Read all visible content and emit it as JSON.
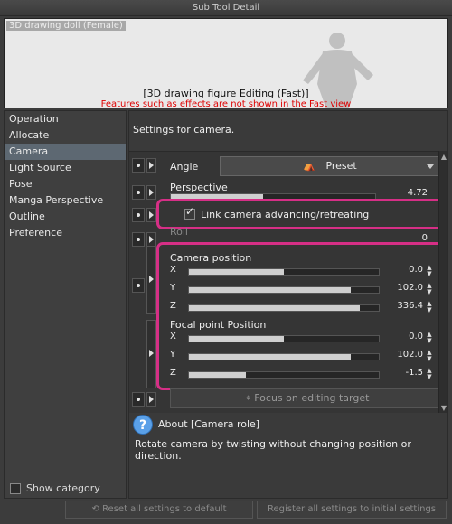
{
  "window": {
    "title": "Sub Tool Detail"
  },
  "preview": {
    "doll_name": "3D drawing doll (Female)",
    "mode_text": "[3D drawing figure Editing (Fast)]",
    "warning_text": "Features such as effects are not shown in the Fast view"
  },
  "sidebar": {
    "items": [
      {
        "label": "Operation"
      },
      {
        "label": "Allocate"
      },
      {
        "label": "Camera"
      },
      {
        "label": "Light Source"
      },
      {
        "label": "Pose"
      },
      {
        "label": "Manga Perspective"
      },
      {
        "label": "Outline"
      },
      {
        "label": "Preference"
      }
    ],
    "active": "Camera",
    "show_category_label": "Show category"
  },
  "main": {
    "heading": "Settings for camera.",
    "angle": {
      "label": "Angle",
      "preset_label": "Preset"
    },
    "perspective": {
      "label": "Perspective",
      "value": "4.72"
    },
    "link_camera": {
      "label": "Link camera advancing/retreating",
      "checked": true
    },
    "roll": {
      "label": "Roll",
      "value": "0"
    },
    "camera_position": {
      "label": "Camera position",
      "x": {
        "axis": "X",
        "value": "0.0",
        "level": 0.5
      },
      "y": {
        "axis": "Y",
        "value": "102.0",
        "level": 0.85
      },
      "z": {
        "axis": "Z",
        "value": "336.4",
        "level": 0.9
      }
    },
    "focal_point": {
      "label": "Focal point Position",
      "x": {
        "axis": "X",
        "value": "0.0",
        "level": 0.5
      },
      "y": {
        "axis": "Y",
        "value": "102.0",
        "level": 0.85
      },
      "z": {
        "axis": "Z",
        "value": "-1.5",
        "level": 0.3
      }
    },
    "focus_button": "Focus on editing target"
  },
  "about": {
    "title": "About [Camera role]",
    "description": "Rotate camera by twisting without changing position or direction."
  },
  "bottom": {
    "reset_label": "Reset all settings to default",
    "register_label": "Register all settings to initial settings"
  },
  "colors": {
    "highlight": "#d62f86",
    "active_item": "#5d6872",
    "warning": "#dd0000"
  }
}
